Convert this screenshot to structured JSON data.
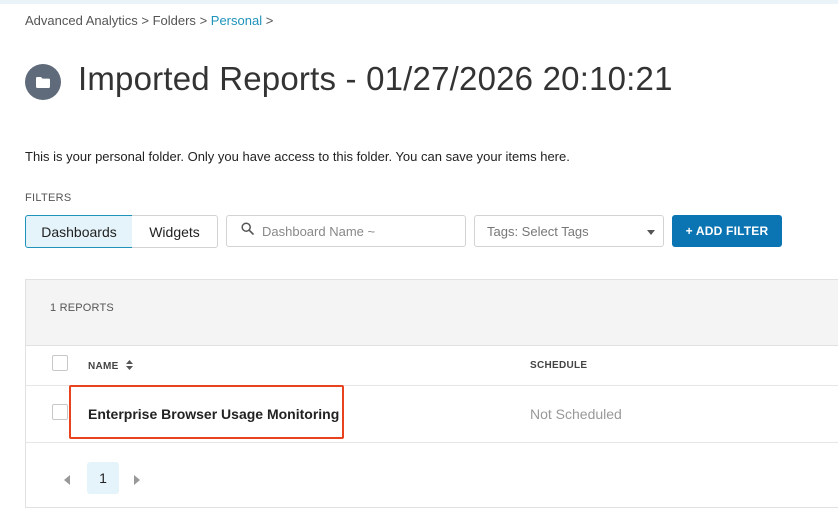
{
  "breadcrumb": {
    "items": [
      {
        "label": "Advanced Analytics"
      },
      {
        "label": "Folders"
      },
      {
        "label": "Personal"
      }
    ],
    "separator": ">"
  },
  "header": {
    "icon": "folder-icon",
    "title": "Imported Reports - 01/27/2026 20:10:21"
  },
  "description": "This is your personal folder. Only you have access to this folder. You can save your items here.",
  "filters": {
    "label": "FILTERS",
    "tabs": [
      {
        "label": "Dashboards",
        "active": true
      },
      {
        "label": "Widgets",
        "active": false
      }
    ],
    "search": {
      "placeholder": "Dashboard Name ~",
      "value": ""
    },
    "tags": {
      "label": "Tags: Select Tags"
    },
    "add_filter_label": "+ ADD FILTER"
  },
  "reports": {
    "count_label": "1 REPORTS",
    "columns": {
      "name": "NAME",
      "schedule": "SCHEDULE"
    },
    "rows": [
      {
        "name": "Enterprise Browser Usage Monitoring",
        "schedule": "Not Scheduled",
        "highlighted": true
      }
    ]
  },
  "pagination": {
    "current_page": "1"
  },
  "colors": {
    "accent": "#1f93ba",
    "primary_button": "#0b74b3",
    "highlight": "#e8421f",
    "active_tab_bg": "#e5f4fa"
  }
}
